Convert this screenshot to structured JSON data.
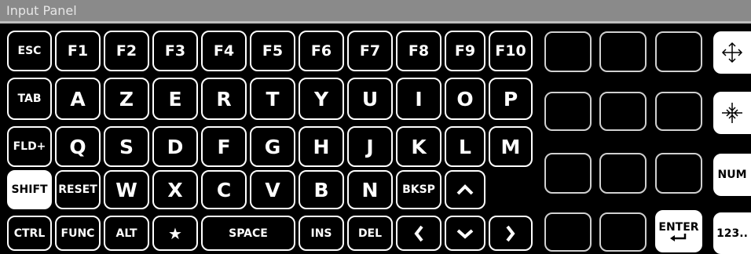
{
  "window": {
    "title": "Input Panel"
  },
  "colors": {
    "background": "#000000",
    "key_border": "#ffffff",
    "titlebar": "#8a8a8a",
    "title_text": "#e6e6e6"
  },
  "keys": {
    "esc": "ESC",
    "f1": "F1",
    "f2": "F2",
    "f3": "F3",
    "f4": "F4",
    "f5": "F5",
    "f6": "F6",
    "f7": "F7",
    "f8": "F8",
    "f9": "F9",
    "f10": "F10",
    "tab": "TAB",
    "a": "A",
    "z": "Z",
    "e": "E",
    "r": "R",
    "t": "T",
    "y": "Y",
    "u": "U",
    "i": "I",
    "o": "O",
    "p": "P",
    "fld_plus": "FLD+",
    "q": "Q",
    "s": "S",
    "d": "D",
    "f": "F",
    "g": "G",
    "h": "H",
    "j": "J",
    "k": "K",
    "l": "L",
    "m": "M",
    "shift": "SHIFT",
    "reset": "RESET",
    "w": "W",
    "x": "X",
    "c": "C",
    "v": "V",
    "b": "B",
    "n": "N",
    "bksp": "BKSP",
    "ctrl": "CTRL",
    "func": "FUNC",
    "alt": "ALT",
    "star": "★",
    "space": "SPACE",
    "ins": "INS",
    "del": "DEL",
    "num": "NUM",
    "enter": "ENTER",
    "numeric": "123.."
  },
  "icons": {
    "arrow_up": "chevron-up-icon",
    "arrow_left": "chevron-left-icon",
    "arrow_down": "chevron-down-icon",
    "arrow_right": "chevron-right-icon",
    "move": "move-arrows-icon",
    "center": "crosshair-arrows-icon",
    "enter": "enter-arrow-icon"
  },
  "state": {
    "shift_active": true
  }
}
